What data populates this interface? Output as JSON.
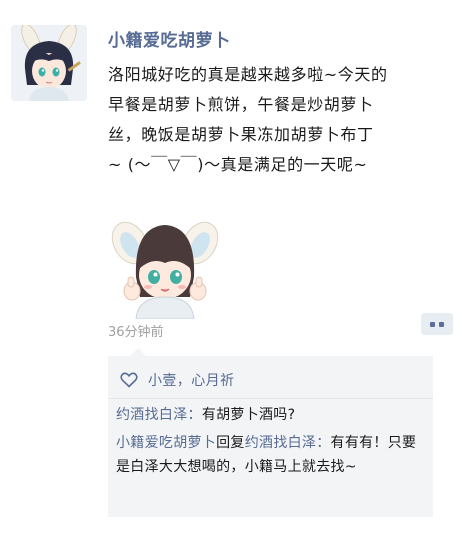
{
  "post": {
    "nickname": "小籍爱吃胡萝卜",
    "content": "洛阳城好吃的真是越来越多啦~今天的\n早餐是胡萝卜煎饼，午餐是炒胡萝卜\n丝，晚饭是胡萝卜果冻加胡萝卜布丁\n~ (～￣▽￣)～真是满足的一天呢~",
    "time": "36分钟前"
  },
  "likes": {
    "names": "小壹，心月祈"
  },
  "comments": [
    {
      "author": "约酒找白泽",
      "separator": "：",
      "text": "有胡萝卜酒吗?"
    },
    {
      "author": "小籍爱吃胡萝卜",
      "reply_word": "回复",
      "reply_to": "约酒找白泽",
      "separator": "：",
      "text": "有有有！只要是白泽大大想喝的，小籍马上就去找~"
    }
  ],
  "colors": {
    "name_blue": "#576b95",
    "time_gray": "#a0a0a0",
    "comment_bg": "#f3f4f6"
  }
}
